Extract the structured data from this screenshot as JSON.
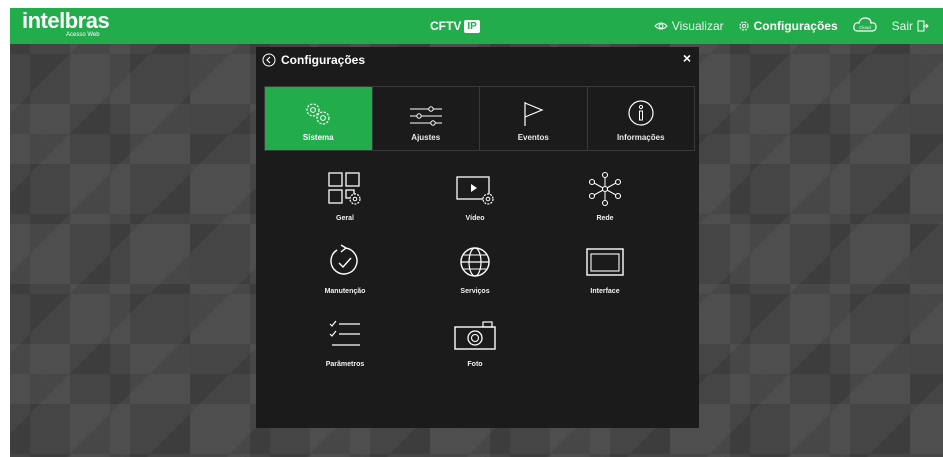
{
  "header": {
    "brand": "intelbras",
    "brand_sub": "Acesso Web",
    "center_brand": "CFTV",
    "center_brand_badge": "IP",
    "nav": {
      "visualizar": "Visualizar",
      "configuracoes": "Configurações",
      "cloud_badge": "Cloud",
      "sair": "Sair"
    }
  },
  "dialog": {
    "title": "Configurações",
    "close": "×",
    "tabs": [
      {
        "label": "Sistema",
        "icon": "gears-icon",
        "active": true
      },
      {
        "label": "Ajustes",
        "icon": "sliders-icon",
        "active": false
      },
      {
        "label": "Eventos",
        "icon": "flag-icon",
        "active": false
      },
      {
        "label": "Informações",
        "icon": "info-icon",
        "active": false
      }
    ],
    "items": [
      {
        "label": "Geral",
        "icon": "general-grid-icon"
      },
      {
        "label": "Vídeo",
        "icon": "video-settings-icon"
      },
      {
        "label": "Rede",
        "icon": "network-icon"
      },
      {
        "label": "Manutenção",
        "icon": "maintenance-icon"
      },
      {
        "label": "Serviços",
        "icon": "globe-icon"
      },
      {
        "label": "Interface",
        "icon": "interface-icon"
      },
      {
        "label": "Parâmetros",
        "icon": "parameters-list-icon"
      },
      {
        "label": "Foto",
        "icon": "camera-icon"
      }
    ]
  },
  "colors": {
    "accent": "#22ac4b",
    "dialog_bg": "#1b1b1b",
    "viewport_bg": "#454545"
  }
}
